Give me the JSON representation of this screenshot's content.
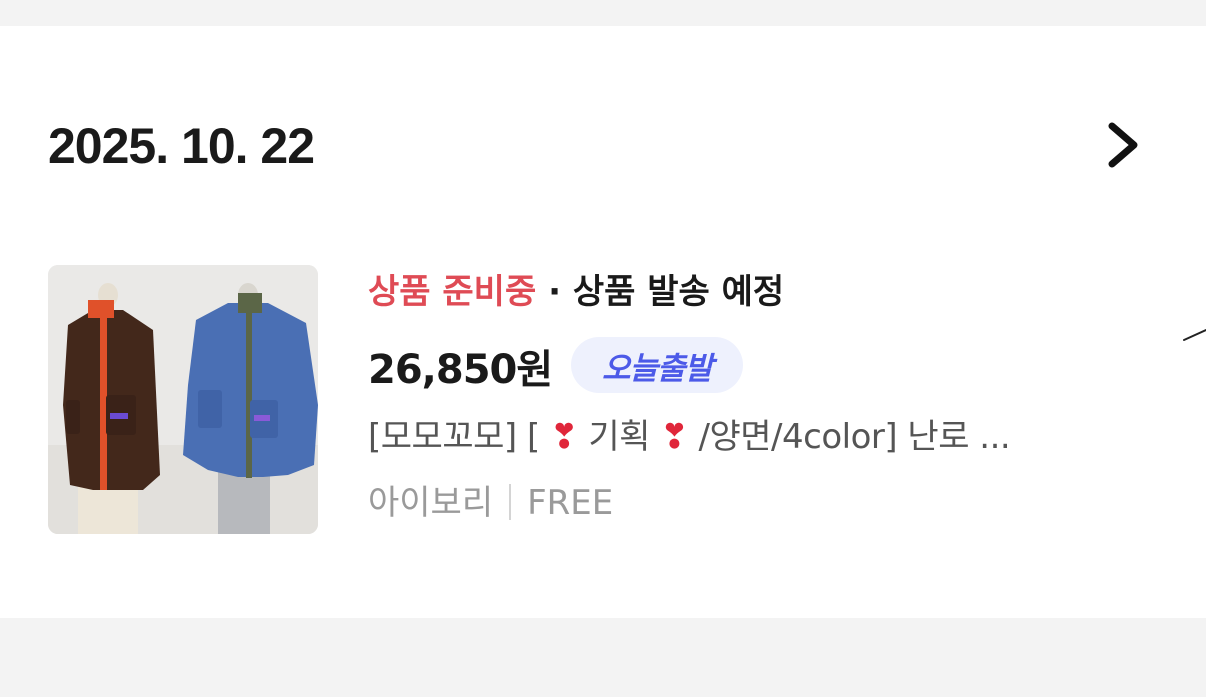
{
  "order": {
    "date": "2025. 10. 22",
    "status_preparing": "상품 준비중",
    "status_separator": " · ",
    "status_shipping": "상품 발송 예정",
    "price": "26,850원",
    "badge": "오늘출발",
    "title_prefix": "[모모꼬모] [ ",
    "title_mid": " 기획 ",
    "title_suffix": " /양면/4color] 난로 ...",
    "title_icon": "heart-exclamation-icon",
    "option_color": "아이보리",
    "option_size": "FREE",
    "thumbnail": "jacket-product-thumbnail"
  },
  "colors": {
    "status_red": "#df4b55",
    "badge_text": "#4c5ae8",
    "badge_bg": "#eef1fd"
  }
}
